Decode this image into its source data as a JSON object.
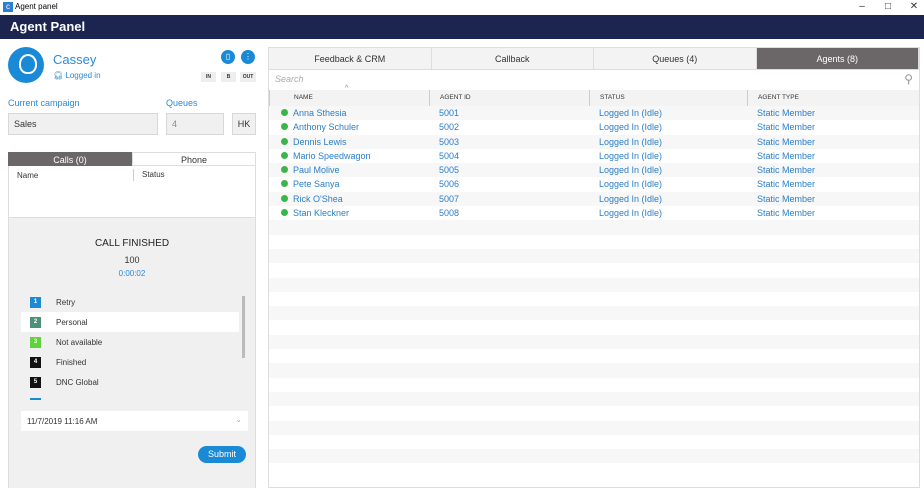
{
  "window": {
    "title": "Agent panel",
    "minimize": "–",
    "maximize": "□",
    "close": "✕"
  },
  "header": {
    "title": "Agent Panel"
  },
  "agent": {
    "name": "Cassey",
    "status": "Logged in",
    "buttons": {
      "in": "IN",
      "b": "B",
      "out": "OUT"
    }
  },
  "campaign": {
    "label": "Current campaign",
    "value": "Sales"
  },
  "queues": {
    "label": "Queues",
    "value": "4",
    "hk": "HK"
  },
  "calls_tabs": [
    {
      "label": "Calls (0)",
      "active": true
    },
    {
      "label": "Phone",
      "active": false
    }
  ],
  "calls_columns": [
    "Name",
    "Status"
  ],
  "call_result": {
    "title": "CALL FINISHED",
    "number": "100",
    "duration": "0:00:02"
  },
  "dispositions": [
    {
      "num": "1",
      "label": "Retry",
      "color": "#1a8ad6"
    },
    {
      "num": "2",
      "label": "Personal",
      "color": "#4e8f7c",
      "selected": true
    },
    {
      "num": "3",
      "label": "Not available",
      "color": "#5fd43a"
    },
    {
      "num": "4",
      "label": "Finished",
      "color": "#111111"
    },
    {
      "num": "5",
      "label": "DNC Global",
      "color": "#111111"
    }
  ],
  "datetime": "11/7/2019 11:16 AM",
  "submit": "Submit",
  "tabs": [
    {
      "label": "Feedback & CRM"
    },
    {
      "label": "Callback"
    },
    {
      "label": "Queues (4)"
    },
    {
      "label": "Agents (8)",
      "active": true
    }
  ],
  "search": {
    "placeholder": "Search"
  },
  "table": {
    "columns": [
      "NAME",
      "AGENT ID",
      "STATUS",
      "AGENT TYPE"
    ],
    "rows": [
      [
        "Anna Sthesia",
        "5001",
        "Logged In (Idle)",
        "Static Member"
      ],
      [
        "Anthony Schuler",
        "5002",
        "Logged In (Idle)",
        "Static Member"
      ],
      [
        "Dennis Lewis",
        "5003",
        "Logged In (Idle)",
        "Static Member"
      ],
      [
        "Mario Speedwagon",
        "5004",
        "Logged In (Idle)",
        "Static Member"
      ],
      [
        "Paul Molive",
        "5005",
        "Logged In (Idle)",
        "Static Member"
      ],
      [
        "Pete Sanya",
        "5006",
        "Logged In (Idle)",
        "Static Member"
      ],
      [
        "Rick O'Shea",
        "5007",
        "Logged In (Idle)",
        "Static Member"
      ],
      [
        "Stan Kleckner",
        "5008",
        "Logged In (Idle)",
        "Static Member"
      ]
    ]
  }
}
